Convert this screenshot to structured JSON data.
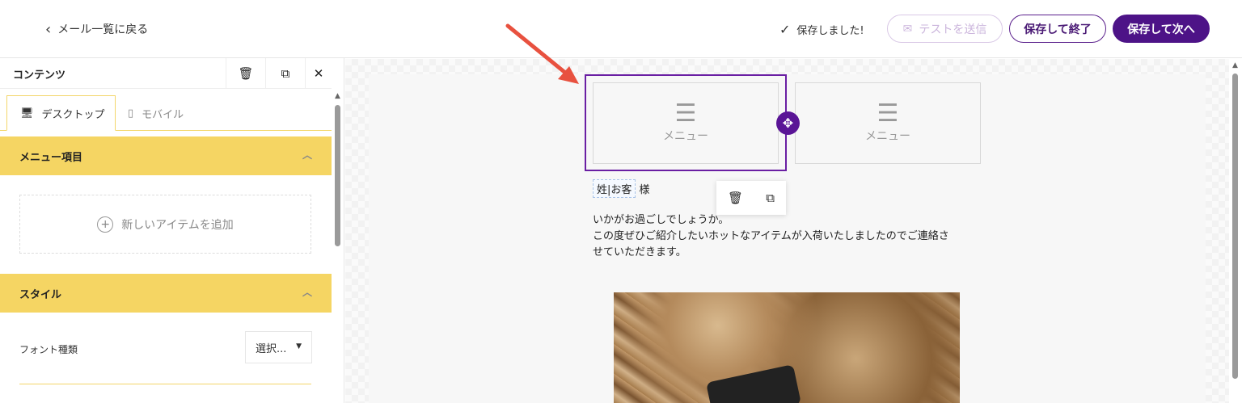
{
  "header": {
    "back_label": "メール一覧に戻る",
    "saved_status": "保存しました!",
    "send_test_label": "テストを送信",
    "save_end_label": "保存して終了",
    "save_next_label": "保存して次へ"
  },
  "panel": {
    "title": "コンテンツ",
    "tabs": [
      {
        "label": "デスクトップ",
        "active": true
      },
      {
        "label": "モバイル",
        "active": false
      }
    ],
    "menu_section": "メニュー項目",
    "add_item_label": "新しいアイテムを追加",
    "style_section": "スタイル",
    "font_label": "フォント種類",
    "font_select_value": "選択..."
  },
  "canvas": {
    "menu_blocks": [
      "メニュー",
      "メニュー"
    ],
    "variable_tag": "姓|お客",
    "greeting_suffix": "様",
    "body_lines": [
      "いかがお過ごしでしょうか。",
      "この度ぜひご紹介したいホットなアイテムが入荷いたしましたのでご連絡さ",
      "せていただきます。"
    ]
  },
  "colors": {
    "accent_purple": "#4d1387",
    "section_yellow": "#f5d563",
    "arrow_red": "#e8513f"
  }
}
